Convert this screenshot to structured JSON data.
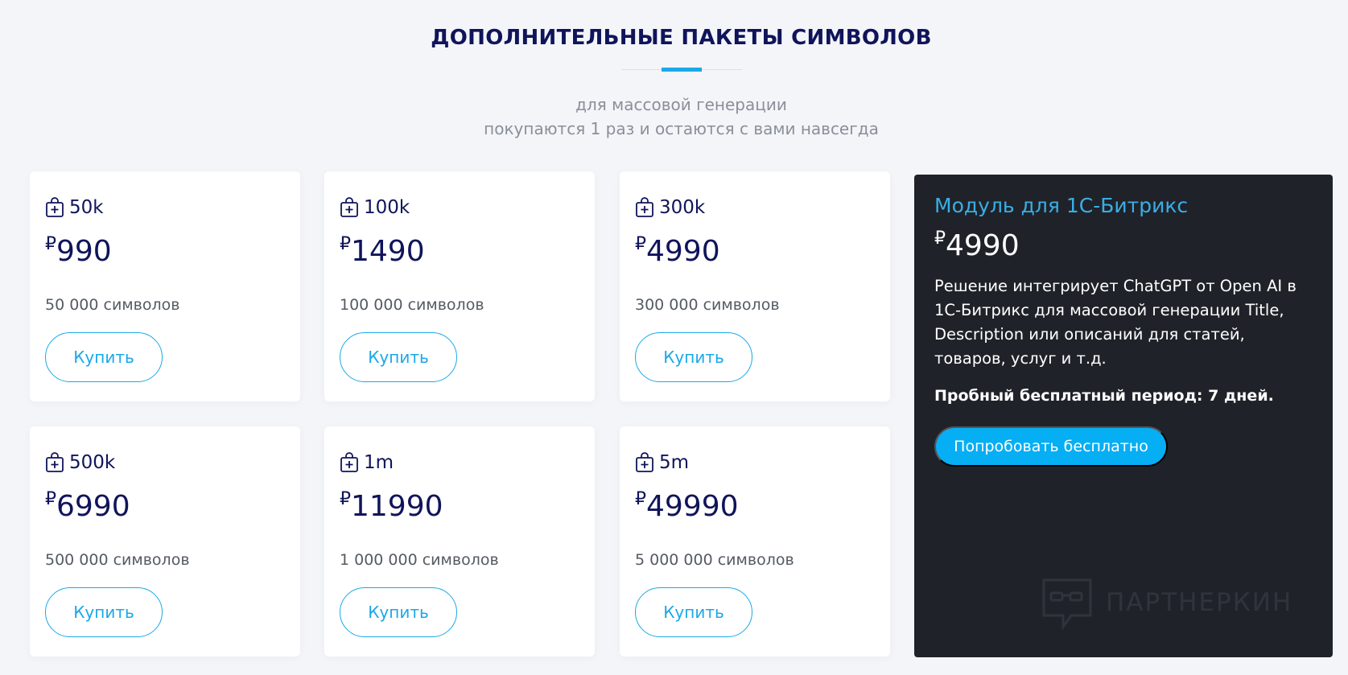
{
  "section": {
    "title": "ДОПОЛНИТЕЛЬНЫЕ ПАКЕТЫ СИМВОЛОВ",
    "subtitle_line1": "для массовой генерации",
    "subtitle_line2": "покупаются 1 раз и остаются с вами навсегда"
  },
  "currency_symbol": "₽",
  "packages": [
    {
      "name": "50k",
      "price": "990",
      "description": "50 000 символов",
      "button_label": "Купить"
    },
    {
      "name": "100k",
      "price": "1490",
      "description": "100 000 символов",
      "button_label": "Купить"
    },
    {
      "name": "300k",
      "price": "4990",
      "description": "300 000 символов",
      "button_label": "Купить"
    },
    {
      "name": "500k",
      "price": "6990",
      "description": "500 000 символов",
      "button_label": "Купить"
    },
    {
      "name": "1m",
      "price": "11990",
      "description": "1 000 000 символов",
      "button_label": "Купить"
    },
    {
      "name": "5m",
      "price": "49990",
      "description": "5 000 000 символов",
      "button_label": "Купить"
    }
  ],
  "module": {
    "title": "Модуль для 1С-Битрикс",
    "price": "4990",
    "description": "Решение интегрирует ChatGPT от Open AI в 1С-Битрикс для массовой генерации Title, Description или описаний для статей, товаров, услуг и т.д.",
    "trial_note": "Пробный бесплатный период: 7 дней.",
    "trial_button_label": "Попробовать бесплатно"
  },
  "watermark": {
    "text": "ПАРТНЕРКИН",
    "icon": "chat-glasses-icon"
  },
  "icons": {
    "package": "shopping-bag-plus-icon"
  },
  "colors": {
    "background": "#f4f5f9",
    "title": "#10145a",
    "accent": "#1aa8e8",
    "module_background": "#1f2329",
    "module_title": "#3aaee6",
    "trial_button": "#06aef4"
  }
}
